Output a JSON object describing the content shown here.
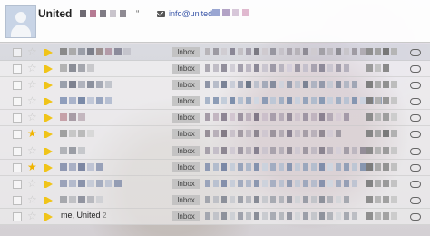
{
  "header": {
    "sender_name": "United",
    "sender_suffix": "“",
    "email": "info@united",
    "redact_sender": [
      "#6e6a72",
      "#b57a93",
      "#7f7b84",
      "#c9c4cc",
      "#8e8a92"
    ],
    "redact_email": [
      "#9aa6d2",
      "#b3a3c6",
      "#d7c7d9",
      "#e0b9cf"
    ]
  },
  "rows": [
    {
      "starred": false,
      "sender": "",
      "count": "",
      "label": "Inbox",
      "sender_px": [
        "#8a8a8a",
        "#aaaaaa",
        "#9a9ea8",
        "#7c7f8a",
        "#9c8f8f",
        "#b39aa8",
        "#8b8b9b",
        "#c4c4cc"
      ],
      "subject_px": [
        "#b7b4b8",
        "#9c9aa2",
        "#d0cdd2",
        "#8a8796",
        "#c3c0c5",
        "#a4a0ac",
        "#7b7a83",
        "#cfcacf",
        "#9796a0",
        "#c6c2c9",
        "#a9a4ad",
        "#b6b2b8",
        "#8e8b95",
        "#cfcbd0",
        "#a2a0a6",
        "#bbb8be",
        "#8d8c93",
        "#c8c5ca",
        "#9f9ba3",
        "#b0acb3"
      ],
      "date_px": [
        "#8e8e8e",
        "#a0a0a0",
        "#777777",
        "#b5b5b5"
      ]
    },
    {
      "starred": false,
      "sender": "",
      "count": "",
      "label": "Inbox",
      "sender_px": [
        "#b3b3b3",
        "#8b8e97",
        "#a5a7ae",
        "#c9c9cc"
      ],
      "subject_px": [
        "#aaa7b0",
        "#c0bdc6",
        "#928f9b",
        "#d1ced6",
        "#a39fac",
        "#bcb7c3",
        "#8b8896",
        "#c9c5cf",
        "#9e9aa7",
        "#b8b4bf",
        "#d5cfdb",
        "#9c97a4",
        "#c4c0cc",
        "#a8a3b0",
        "#8e8a99",
        "#cac6d0",
        "#a19daa",
        "#b5b1bd"
      ],
      "date_px": [
        "#9b9b9b",
        "#c2c2c2",
        "#8a8a8a"
      ]
    },
    {
      "starred": false,
      "sender": "",
      "count": "",
      "label": "Inbox",
      "sender_px": [
        "#9aa0ac",
        "#7e8290",
        "#b0b3bd",
        "#8c919e",
        "#a7abb6",
        "#c2c5cc"
      ],
      "subject_px": [
        "#8f95a7",
        "#b7bcc9",
        "#7b8396",
        "#c9cdd8",
        "#9aa1b2",
        "#6e7889",
        "#bcc1cd",
        "#a4aab9",
        "#858c9d",
        "#d0d3dc",
        "#959cad",
        "#c0c4cf",
        "#7c8394",
        "#aeb3c1",
        "#9399aa",
        "#c5c9d3",
        "#8a91a2",
        "#b2b7c4",
        "#a0a6b5"
      ],
      "date_px": [
        "#7f7f7f",
        "#a9a9a9",
        "#909090",
        "#bdbdbd"
      ]
    },
    {
      "starred": false,
      "sender": "",
      "count": "",
      "label": "Inbox",
      "sender_px": [
        "#8f9ebc",
        "#aab4cb",
        "#7a8aa8",
        "#c1c8d8",
        "#99a6c0",
        "#b6bfd2"
      ],
      "subject_px": [
        "#a8b5c9",
        "#8c9cb6",
        "#c3cdda",
        "#7d8fac",
        "#b5c1d2",
        "#9aa9c0",
        "#d0d7e2",
        "#8b9bb5",
        "#bdc7d6",
        "#a2b0c5",
        "#7f90ad",
        "#c8d0dd",
        "#94a3bb",
        "#b0bccd",
        "#889ab4",
        "#c5cdda",
        "#9faec3",
        "#b9c3d3",
        "#8596b1",
        "#ccd3df",
        "#a5b2c6",
        "#93a2ba"
      ],
      "date_px": [
        "#7e7e7e",
        "#b0b0b0",
        "#969696",
        "#c6c6c6"
      ]
    },
    {
      "starred": false,
      "sender": "",
      "count": "",
      "label": "Inbox",
      "sender_px": [
        "#c6a1a9",
        "#a89ca6",
        "#c4b7bf"
      ],
      "subject_px": [
        "#a59ba7",
        "#c3b6c1",
        "#8e8594",
        "#d2c5d0",
        "#9d93a1",
        "#bcb0bc",
        "#827988",
        "#cbbfca",
        "#a89eab",
        "#b7adb9",
        "#938a99",
        "#cec3cd",
        "#9f96a4",
        "#c0b4bf",
        "#8b8291",
        "#b4aab6",
        "#d6cbd5",
        "#a49aa8"
      ],
      "date_px": [
        "#8c8c8c",
        "#b9b9b9",
        "#9e9e9e",
        "#cdcdcd"
      ]
    },
    {
      "starred": true,
      "sender": "",
      "count": "",
      "label": "Inbox",
      "sender_px": [
        "#a0a0a0",
        "#c7c7c7",
        "#bababa",
        "#d8d8d8"
      ],
      "subject_px": [
        "#978f98",
        "#b8b0b9",
        "#847c86",
        "#c9c1ca",
        "#a39ba4",
        "#bdb5be",
        "#8e8690",
        "#cfc7d0",
        "#9c949d",
        "#b3abb4",
        "#898191",
        "#c6bec7",
        "#a69ea7",
        "#b9b1ba",
        "#918993",
        "#d3cbd4",
        "#a09aa3"
      ],
      "date_px": [
        "#858585",
        "#a3a3a3",
        "#7a7a7a",
        "#b1b1b1"
      ]
    },
    {
      "starred": false,
      "sender": "",
      "count": "",
      "label": "Inbox",
      "sender_px": [
        "#b1b3b8",
        "#9a9da5",
        "#c6c8cc"
      ],
      "subject_px": [
        "#a59fa9",
        "#c4bec8",
        "#8d8792",
        "#d0cad3",
        "#9f99a4",
        "#bbb5be",
        "#878190",
        "#cbc5ce",
        "#a8a2ac",
        "#b7b1ba",
        "#918b96",
        "#cfc9d2",
        "#9e98a2",
        "#c0bac3",
        "#8a8490",
        "#b4aeb8",
        "#d5cfd8",
        "#a39da7",
        "#bdb7c0",
        "#938d98"
      ],
      "date_px": [
        "#8a8a8a",
        "#b4b4b4",
        "#9b9b9b",
        "#c8c8c8"
      ]
    },
    {
      "starred": true,
      "sender": "",
      "count": "",
      "label": "Inbox",
      "sender_px": [
        "#8f98b2",
        "#a9b0c5",
        "#7d87a3",
        "#bfc4d4",
        "#98a1b9"
      ],
      "subject_px": [
        "#8e9ab4",
        "#b2bccd",
        "#7b88a6",
        "#c5cdd9",
        "#98a4bb",
        "#adb8ca",
        "#8492ae",
        "#cbd2dd",
        "#a1acc1",
        "#b8c1d1",
        "#8896b1",
        "#c1c9d6",
        "#9ba7bd",
        "#b4bece",
        "#808eab",
        "#cfd5df",
        "#a6b1c5",
        "#929fb7",
        "#bdc6d4",
        "#8796b0",
        "#c7ced9"
      ],
      "date_px": [
        "#7c7c7c",
        "#a8a8a8",
        "#939393",
        "#c0c0c0"
      ]
    },
    {
      "starred": false,
      "sender": "",
      "count": "",
      "label": "Inbox",
      "sender_px": [
        "#9ba3b9",
        "#b4bbcc",
        "#8a93ab",
        "#c6cbd7",
        "#a5adc0",
        "#bfc5d3",
        "#949db4"
      ],
      "subject_px": [
        "#9aa4bb",
        "#b9c1d0",
        "#8590ab",
        "#c7cdd9",
        "#a2abbf",
        "#b1b9ca",
        "#8c97b0",
        "#cdd2dc",
        "#a7afc2",
        "#bac1d0",
        "#919bb2",
        "#c3c9d5",
        "#9fa8bd",
        "#b5bccc",
        "#8792ad",
        "#d1d6df",
        "#a4adc1",
        "#969fb5",
        "#bec4d2"
      ],
      "date_px": [
        "#838383",
        "#ababab",
        "#9a9a9a",
        "#c3c3c3"
      ]
    },
    {
      "starred": false,
      "sender": "",
      "count": "",
      "label": "Inbox",
      "sender_px": [
        "#a6a8ad",
        "#c0c1c5",
        "#9194a0",
        "#b8b9bf",
        "#d0d1d5"
      ],
      "subject_px": [
        "#a2a5ad",
        "#bec0c6",
        "#8c909a",
        "#cbcdd2",
        "#9ea1aa",
        "#b7b9c0",
        "#878b96",
        "#c7c9ce",
        "#a7aab2",
        "#b3b5bc",
        "#9295a0",
        "#d1d3d7",
        "#9a9da7",
        "#c2c4c9",
        "#8d919b",
        "#b0b2b9",
        "#d4d6da",
        "#a5a8b0"
      ],
      "date_px": [
        "#8d8d8d",
        "#b6b6b6",
        "#a1a1a1",
        "#cacaca"
      ]
    },
    {
      "starred": false,
      "sender": "me, United",
      "count": "2",
      "label": "Inbox",
      "sender_px": [],
      "subject_px": [
        "#a4a7b0",
        "#c1c3c9",
        "#8e929c",
        "#cdd0d5",
        "#9fa2ac",
        "#b9bcc2",
        "#898d98",
        "#c9cbd0",
        "#a9acb4",
        "#b5b8be",
        "#9497a2",
        "#d3d5d9",
        "#9c9fa9",
        "#c4c6cb",
        "#8f939d",
        "#b2b5bb",
        "#d6d8dc",
        "#a6a9b1",
        "#bcbec4"
      ],
      "date_px": [
        "#8f8f8f",
        "#b8b8b8",
        "#a3a3a3",
        "#cccccc"
      ]
    }
  ]
}
